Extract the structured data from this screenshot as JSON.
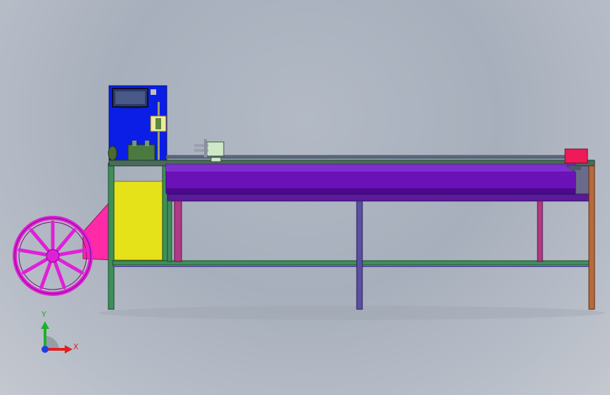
{
  "triad": {
    "y_label": "Y",
    "x_label": "X"
  },
  "colors": {
    "background": "#aab2be",
    "control_box": "#0a1ee6",
    "screen": "#2f3a6a",
    "yellow_tank": "#e6e21a",
    "trough": "#6a12b8",
    "trough_top": "#7f2fd0",
    "frame_green": "#3f8f5a",
    "frame_purple": "#5a4fa0",
    "frame_magenta": "#b03a86",
    "frame_orange": "#b86a3a",
    "wheel": "#e020d8",
    "guard": "#ff2aa6",
    "end_block": "#ee1a5a",
    "axis_x": "#e02020",
    "axis_y": "#20b030",
    "axis_origin": "#2040e0"
  }
}
